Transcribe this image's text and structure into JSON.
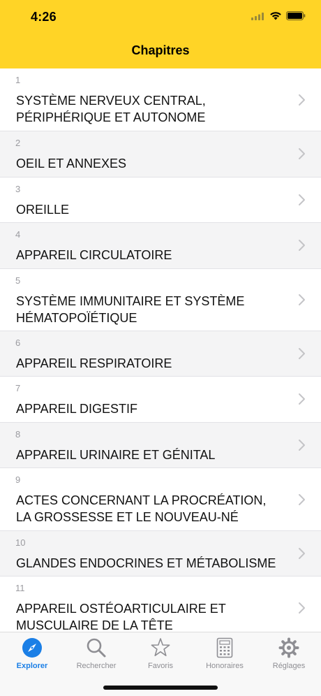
{
  "status_bar": {
    "time": "4:26"
  },
  "nav": {
    "title": "Chapitres"
  },
  "chapters": [
    {
      "number": "1",
      "title": "SYSTÈME NERVEUX CENTRAL, PÉRIPHÉRIQUE ET AUTONOME"
    },
    {
      "number": "2",
      "title": "OEIL ET ANNEXES"
    },
    {
      "number": "3",
      "title": "OREILLE"
    },
    {
      "number": "4",
      "title": "APPAREIL CIRCULATOIRE"
    },
    {
      "number": "5",
      "title": "SYSTÈME IMMUNITAIRE ET SYSTÈME HÉMATOPOÏÉTIQUE"
    },
    {
      "number": "6",
      "title": "APPAREIL RESPIRATOIRE"
    },
    {
      "number": "7",
      "title": "APPAREIL DIGESTIF"
    },
    {
      "number": "8",
      "title": "APPAREIL URINAIRE ET GÉNITAL"
    },
    {
      "number": "9",
      "title": "ACTES CONCERNANT LA PROCRÉATION, LA GROSSESSE ET LE NOUVEAU-NÉ"
    },
    {
      "number": "10",
      "title": "GLANDES ENDOCRINES ET MÉTABOLISME"
    },
    {
      "number": "11",
      "title": "APPAREIL OSTÉOARTICULAIRE ET MUSCULAIRE DE LA TÊTE"
    }
  ],
  "tabs": [
    {
      "label": "Explorer",
      "icon": "compass-icon",
      "active": true
    },
    {
      "label": "Rechercher",
      "icon": "search-icon",
      "active": false
    },
    {
      "label": "Favoris",
      "icon": "star-icon",
      "active": false
    },
    {
      "label": "Honoraires",
      "icon": "calculator-icon",
      "active": false
    },
    {
      "label": "Réglages",
      "icon": "gear-icon",
      "active": false
    }
  ],
  "colors": {
    "header": "#FFD426",
    "accent": "#1B7FE6",
    "inactive": "#8E8E93"
  }
}
